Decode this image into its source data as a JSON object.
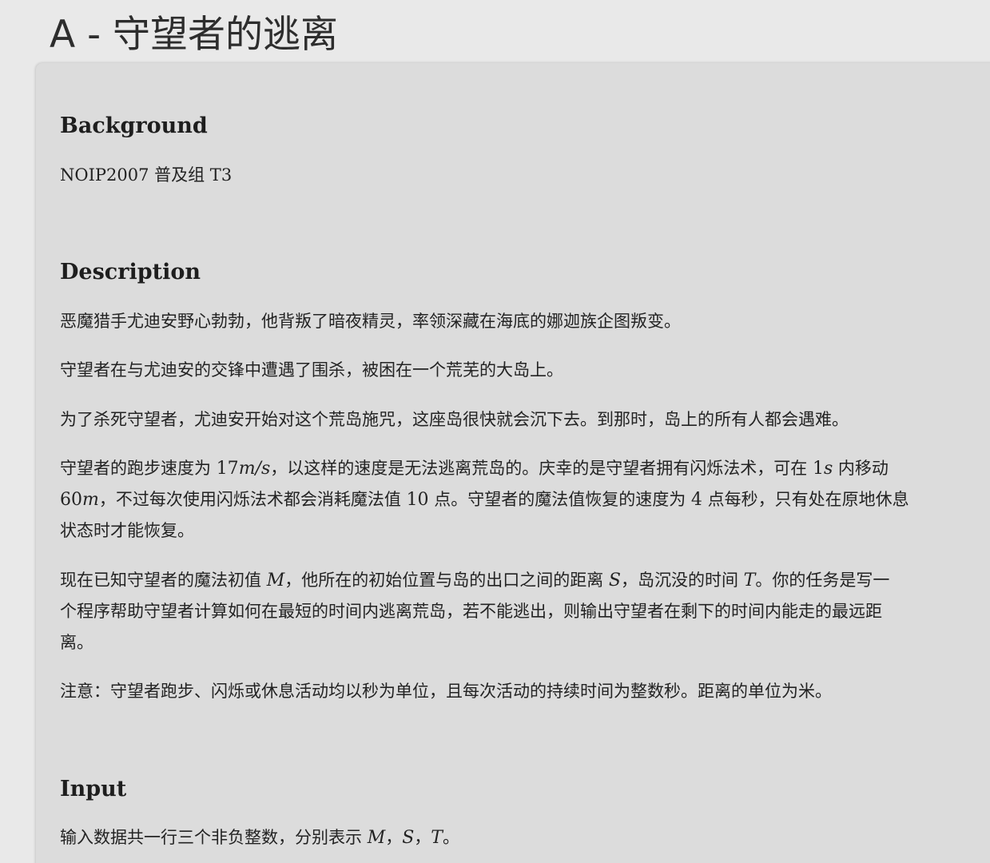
{
  "page": {
    "title": "A - 守望者的逃离"
  },
  "background": {
    "heading": "Background",
    "text": "NOIP2007 普及组 T3"
  },
  "description": {
    "heading": "Description",
    "p1": "恶魔猎手尤迪安野心勃勃，他背叛了暗夜精灵，率领深藏在海底的娜迦族企图叛变。",
    "p2": "守望者在与尤迪安的交锋中遭遇了围杀，被困在一个荒芜的大岛上。",
    "p3": "为了杀死守望者，尤迪安开始对这个荒岛施咒，这座岛很快就会沉下去。到那时，岛上的所有人都会遇难。",
    "p4": {
      "t1": "守望者的跑步速度为 ",
      "speed_num": "17",
      "speed_unit": "m/s",
      "t2": "，以这样的速度是无法逃离荒岛的。庆幸的是守望者拥有闪烁法术，可在 ",
      "time_num": "1",
      "time_unit": "s",
      "t3": " 内移动",
      "dist_num": "60",
      "dist_unit": "m",
      "t4": "，不过每次使用闪烁法术都会消耗魔法值 ",
      "cost": "10",
      "t5": " 点。守望者的魔法值恢复的速度为 ",
      "regen": "4",
      "t6": " 点每秒，只有处在原地休息",
      "t7": "状态时才能恢复。"
    },
    "p5": {
      "t1": "现在已知守望者的魔法初值 ",
      "var_m": "M",
      "t2": "，他所在的初始位置与岛的出口之间的距离 ",
      "var_s": "S",
      "t3": "，岛沉没的时间 ",
      "var_t": "T",
      "t4": "。你的任务是写一",
      "t5": "个程序帮助守望者计算如何在最短的时间内逃离荒岛，若不能逃出，则输出守望者在剩下的时间内能走的最远距",
      "t6": "离。"
    },
    "p6": "注意：守望者跑步、闪烁或休息活动均以秒为单位，且每次活动的持续时间为整数秒。距离的单位为米。"
  },
  "input": {
    "heading": "Input",
    "t1": "输入数据共一行三个非负整数，分别表示 ",
    "var_m": "M",
    "sep1": "，",
    "var_s": "S",
    "sep2": "，",
    "var_t": "T",
    "t2": "。"
  }
}
